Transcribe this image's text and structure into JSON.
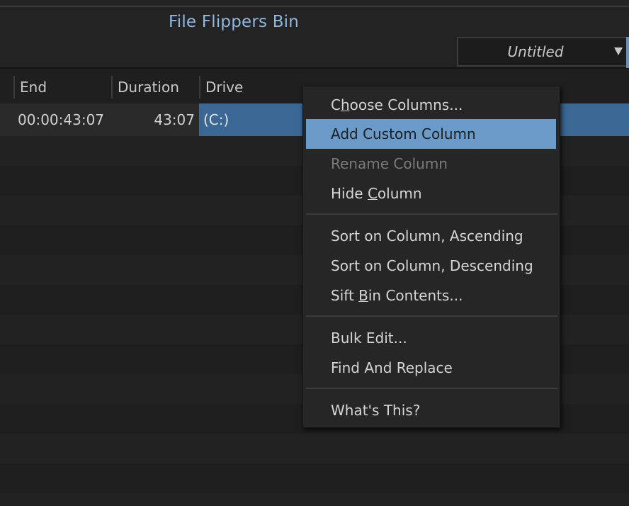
{
  "window": {
    "title": "File Flippers Bin"
  },
  "view_selector": {
    "value": "Untitled",
    "icon": "chevron-down-icon"
  },
  "table": {
    "columns": [
      "End",
      "Duration",
      "Drive"
    ],
    "rows": [
      {
        "end": "00:00:43:07",
        "duration": "43:07",
        "drive": "(C:)"
      }
    ]
  },
  "context_menu": {
    "items": [
      {
        "label": "Choose Columns...",
        "mnemonic": "h",
        "state": "normal"
      },
      {
        "label": "Add Custom Column",
        "state": "highlighted"
      },
      {
        "label": "Rename Column",
        "state": "disabled"
      },
      {
        "label": "Hide Column",
        "mnemonic": "C",
        "state": "normal"
      },
      {
        "label": "Sort on Column, Ascending",
        "state": "normal"
      },
      {
        "label": "Sort on Column, Descending",
        "state": "normal"
      },
      {
        "label": "Sift Bin Contents...",
        "mnemonic": "B",
        "state": "normal"
      },
      {
        "label": "Bulk Edit...",
        "state": "normal"
      },
      {
        "label": "Find And Replace",
        "state": "normal"
      },
      {
        "label": "What's This?",
        "state": "normal"
      }
    ],
    "parts": {
      "choose_a": "C",
      "choose_u": "h",
      "choose_b": "oose Columns...",
      "hide_a": "Hide ",
      "hide_u": "C",
      "hide_b": "olumn",
      "sift_a": "Sift ",
      "sift_u": "B",
      "sift_b": "in Contents..."
    }
  },
  "colors": {
    "background": "#1f1f1f",
    "title_accent": "#8fb8e0",
    "selection": "#3a6794",
    "menu_highlight": "#6a9bc8"
  }
}
